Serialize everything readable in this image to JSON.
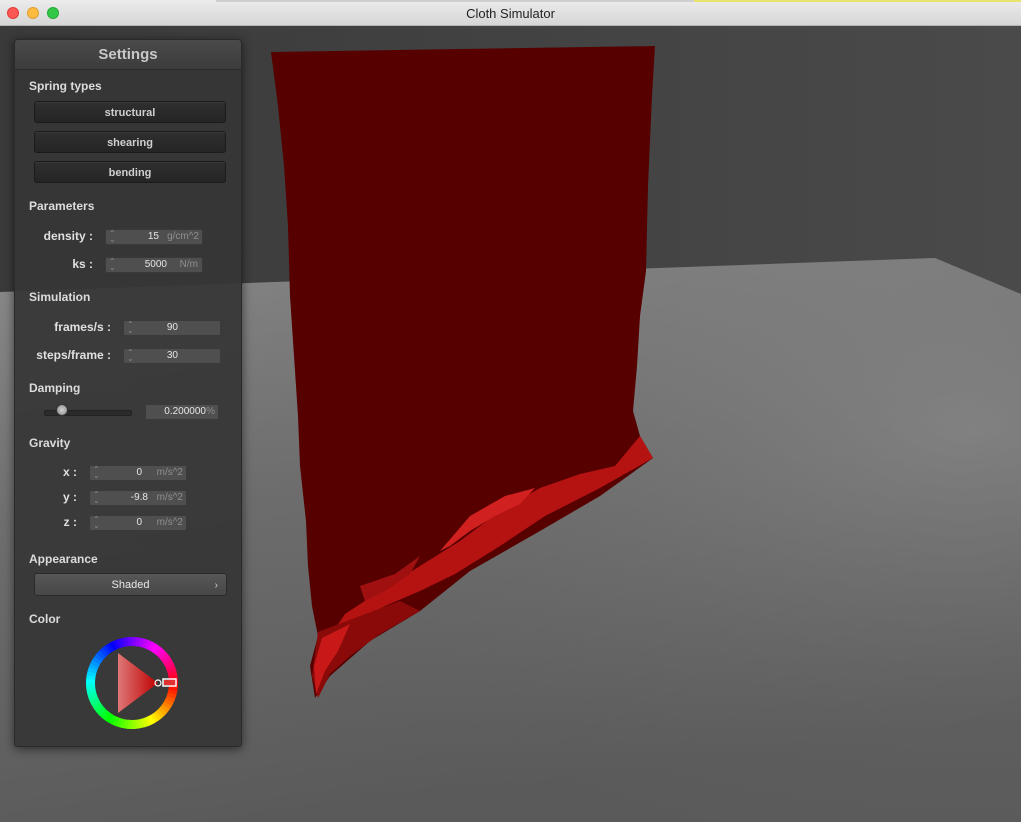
{
  "window": {
    "title": "Cloth Simulator"
  },
  "panel": {
    "title": "Settings",
    "spring_types": {
      "heading": "Spring types",
      "buttons": [
        "structural",
        "shearing",
        "bending"
      ]
    },
    "parameters": {
      "heading": "Parameters",
      "fields": [
        {
          "label": "density :",
          "value": "15",
          "unit": "g/cm^2"
        },
        {
          "label": "ks :",
          "value": "5000",
          "unit": "N/m"
        }
      ]
    },
    "simulation": {
      "heading": "Simulation",
      "fields": [
        {
          "label": "frames/s :",
          "value": "90"
        },
        {
          "label": "steps/frame :",
          "value": "30"
        }
      ]
    },
    "damping": {
      "heading": "Damping",
      "slider_fraction": 0.2,
      "value": "0.200000",
      "unit": "%"
    },
    "gravity": {
      "heading": "Gravity",
      "fields": [
        {
          "label": "x :",
          "value": "0",
          "unit": "m/s^2"
        },
        {
          "label": "y :",
          "value": "-9.8",
          "unit": "m/s^2"
        },
        {
          "label": "z :",
          "value": "0",
          "unit": "m/s^2"
        }
      ]
    },
    "appearance": {
      "heading": "Appearance",
      "selected": "Shaded",
      "chevron": "›"
    },
    "color": {
      "heading": "Color",
      "selected_hex": "#c00000"
    }
  },
  "scene": {
    "cloth_color": "#560000",
    "highlight_color": "#c81818",
    "wall_color": "#434343",
    "floor_color": "#6e6e6e"
  }
}
